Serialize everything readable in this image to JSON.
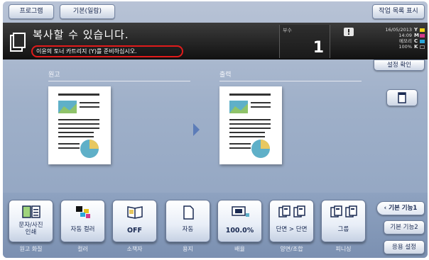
{
  "tabs": {
    "program": "프로그램",
    "default_list": "기본(일람)",
    "job_list": "작업 목록 표시"
  },
  "status": {
    "title": "복사할 수 있습니다.",
    "warning": "이윤의 토너 카트리지 (Y)를 준비하십시오.",
    "copies_label": "부수",
    "copies_value": "1",
    "date": "16/05/2013",
    "time": "14:09",
    "memory_label": "메모리",
    "memory_value": "100%"
  },
  "toner": [
    {
      "letter": "Y",
      "color": "#f2d41a"
    },
    {
      "letter": "M",
      "color": "#d43a8a"
    },
    {
      "letter": "C",
      "color": "#2aa6d9"
    },
    {
      "letter": "K",
      "color": "#202020"
    }
  ],
  "side": {
    "check_settings": "설정 확인",
    "basic_1": "기본 기능1",
    "basic_2": "기본 기능2",
    "application": "응용 설정"
  },
  "preview": {
    "original_label": "원고",
    "output_label": "출력"
  },
  "functions": [
    {
      "value": "문자/사진\n인쇄",
      "caption": "원고 화질",
      "icon": "book-photo-icon"
    },
    {
      "value": "자동 컬러",
      "caption": "컬러",
      "icon": "color-dots-icon"
    },
    {
      "value": "OFF",
      "caption": "소책자",
      "icon": "booklet-icon"
    },
    {
      "value": "자동",
      "caption": "용지",
      "icon": "paper-icon"
    },
    {
      "value": "100.0%",
      "caption": "배율",
      "icon": "zoom-icon"
    },
    {
      "value": "단면 > 단면",
      "caption": "양면/조합",
      "icon": "duplex-icon"
    },
    {
      "value": "그룹",
      "caption": "피니싱",
      "icon": "finishing-icon"
    }
  ]
}
